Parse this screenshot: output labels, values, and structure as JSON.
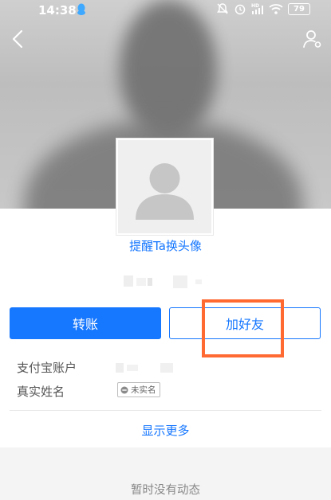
{
  "status_bar": {
    "time": "14:38",
    "battery": "79",
    "icons": [
      "qq-icon",
      "mute-icon",
      "alarm-icon",
      "hd-signal-icon",
      "wifi-icon",
      "battery-icon"
    ]
  },
  "header": {
    "back_icon": "chevron-left-icon",
    "profile_icon": "person-settings-icon"
  },
  "profile": {
    "avatar_icon": "default-person-icon",
    "remind_link": "提醒Ta换头像"
  },
  "actions": {
    "transfer_label": "转账",
    "add_friend_label": "加好友"
  },
  "details": {
    "account_label": "支付宝账户",
    "real_name_label": "真实姓名",
    "unverified_tag": "未实名"
  },
  "show_more": "显示更多",
  "activity": {
    "empty_text": "暂时没有动态"
  },
  "colors": {
    "accent": "#1677ff",
    "highlight": "#ff6a33"
  }
}
